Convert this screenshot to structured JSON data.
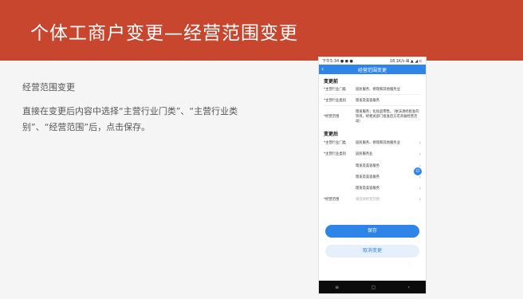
{
  "slide": {
    "title": "个体工商户变更—经营范围变更",
    "subheading": "经营范围变更",
    "instruction": "直接在变更后内容中选择“主营行业门类”、“主营行业类别”、“经营范围”后，点击保存。"
  },
  "phone": {
    "status": {
      "left": "下午5:34 ● ◼ ●",
      "right": "18.1K/s ⊠ ▲ ◢ ⊏"
    },
    "nav": {
      "back": "‹",
      "title": "经营范围变更"
    },
    "before": {
      "title": "变更前",
      "rows": [
        {
          "label": "*主营行业门类",
          "value": "居民服务、修理和其他服务业"
        },
        {
          "label": "*主营行业类别",
          "value": "理发及美容服务"
        },
        {
          "label": "*经营范围",
          "value": "理发服务；化妆品零售。（依法须经批准的项目，经相关部门批准后方可开展经营活动）"
        }
      ]
    },
    "after": {
      "title": "变更后",
      "rows": [
        {
          "label": "*主营行业门类",
          "value": "居民服务、修理和其他服务业"
        },
        {
          "label": "*主营行业类别",
          "value": "居民服务业"
        },
        {
          "label": "",
          "value": "理发及美容服务"
        },
        {
          "label": "",
          "value": "理发及美容服务"
        },
        {
          "label": "",
          "value": "理发及美容服务"
        },
        {
          "label": "*经营范围",
          "value": "请选择经营范围"
        }
      ]
    },
    "float_icon": "⏻",
    "save_label": "保存",
    "cancel_label": "取消变更",
    "sysnav": [
      "≡",
      "▢",
      "‹"
    ],
    "arrow": "›"
  },
  "colors": {
    "banner": "#c8452e",
    "accent": "#2f84e8",
    "cancel_bg": "#e6f0fb"
  },
  "icons": {
    "back": "chevron-left-icon",
    "arrow": "chevron-right-icon",
    "float": "power-icon"
  }
}
